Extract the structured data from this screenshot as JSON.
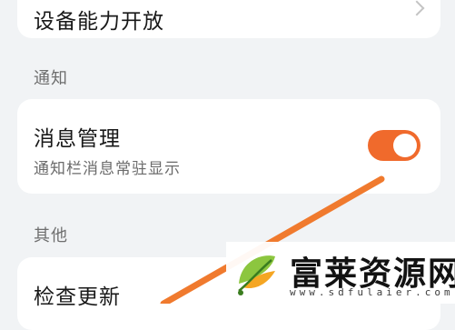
{
  "items": {
    "device": {
      "title": "设备能力开放"
    },
    "message": {
      "title": "消息管理",
      "subtitle": "通知栏消息常驻显示",
      "toggle_on": true
    },
    "update": {
      "title": "检查更新"
    }
  },
  "sections": {
    "notify": "通知",
    "other": "其他"
  },
  "watermark": {
    "name": "富莱资源网",
    "url": "www.sdfulaier.com"
  },
  "colors": {
    "accent": "#f06a2c",
    "stroke": "#f07a2e",
    "background": "#f1f3f5"
  },
  "icons": {
    "chevron": "chevron-right-icon",
    "logo": "leaf-logo"
  }
}
